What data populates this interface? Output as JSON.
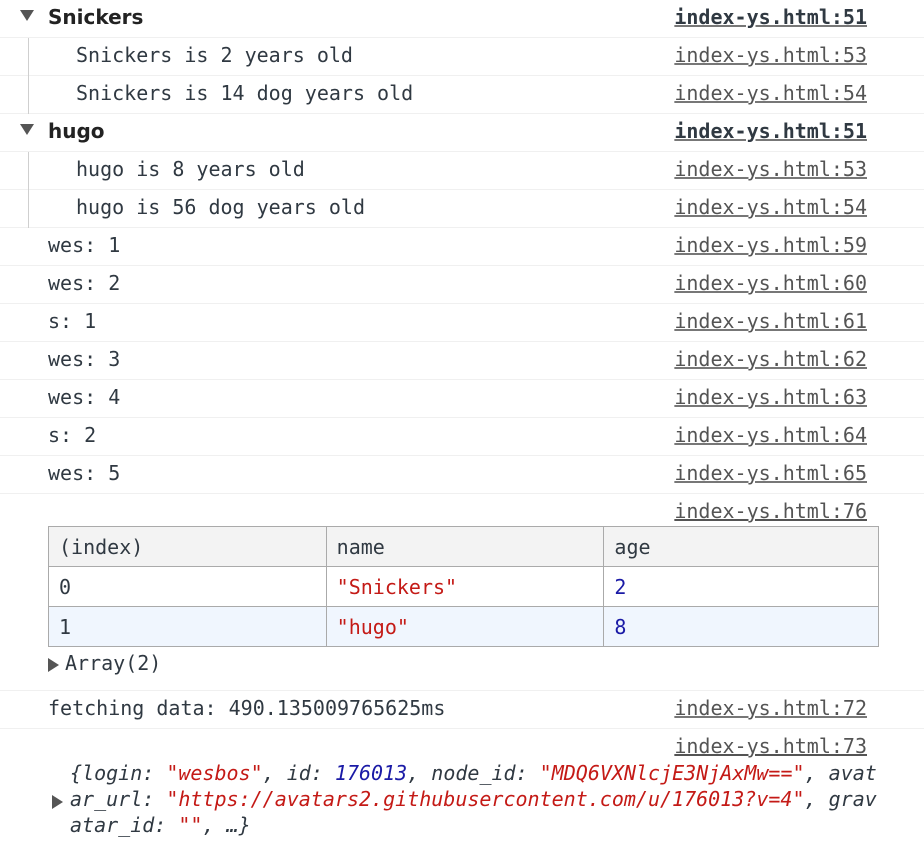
{
  "colors": {
    "string": "#c41a16",
    "number": "#1a1aa6",
    "text": "#303942",
    "link": "#545454"
  },
  "groups": [
    {
      "title": "Snickers",
      "source": "index-ys.html:51",
      "lines": [
        {
          "text": "Snickers is 2 years old",
          "source": "index-ys.html:53"
        },
        {
          "text": "Snickers is 14 dog years old",
          "source": "index-ys.html:54"
        }
      ]
    },
    {
      "title": "hugo",
      "source": "index-ys.html:51",
      "lines": [
        {
          "text": "hugo is 8 years old",
          "source": "index-ys.html:53"
        },
        {
          "text": "hugo is 56 dog years old",
          "source": "index-ys.html:54"
        }
      ]
    }
  ],
  "logs": [
    {
      "text": "wes: 1",
      "source": "index-ys.html:59"
    },
    {
      "text": "wes: 2",
      "source": "index-ys.html:60"
    },
    {
      "text": "s: 1",
      "source": "index-ys.html:61"
    },
    {
      "text": "wes: 3",
      "source": "index-ys.html:62"
    },
    {
      "text": "wes: 4",
      "source": "index-ys.html:63"
    },
    {
      "text": "s: 2",
      "source": "index-ys.html:64"
    },
    {
      "text": "wes: 5",
      "source": "index-ys.html:65"
    }
  ],
  "table": {
    "source": "index-ys.html:76",
    "headers": [
      "(index)",
      "name",
      "age"
    ],
    "rows": [
      {
        "index": "0",
        "name": "\"Snickers\"",
        "age": "2"
      },
      {
        "index": "1",
        "name": "\"hugo\"",
        "age": "8"
      }
    ],
    "array_label": "Array(2)"
  },
  "timer": {
    "text": "fetching data: 490.135009765625ms",
    "source": "index-ys.html:72"
  },
  "object": {
    "source": "index-ys.html:73",
    "open": "{",
    "k_login": "login: ",
    "v_login": "\"wesbos\"",
    "sep1": ", ",
    "k_id": "id: ",
    "v_id": "176013",
    "sep2": ", ",
    "k_node": "node_id: ",
    "v_node": "\"MDQ6VXNlcjE3NjAxMw==\"",
    "sep3": ", ",
    "k_avatar": "avatar_url: ",
    "v_avatar": "\"https://avatars2.githubusercontent.com/u/176013?v=4\"",
    "sep4": ", ",
    "k_grav": "gravatar_id: ",
    "v_grav": "\"\"",
    "tail": ", …}"
  }
}
